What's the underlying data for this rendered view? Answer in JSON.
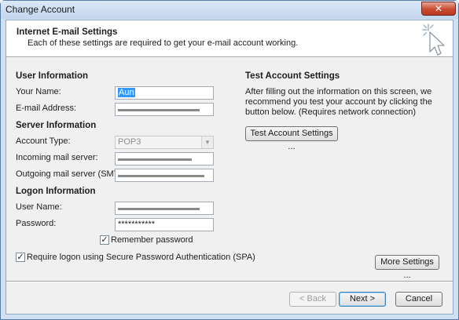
{
  "window": {
    "title": "Change Account",
    "close_glyph": "✕"
  },
  "header": {
    "title": "Internet E-mail Settings",
    "subtitle": "Each of these settings are required to get your e-mail account working.",
    "icon": "cursor-sparkle-icon"
  },
  "user_info": {
    "heading": "User Information",
    "your_name_label": "Your Name:",
    "your_name_value": "Aun",
    "email_label": "E-mail Address:"
  },
  "server_info": {
    "heading": "Server Information",
    "account_type_label": "Account Type:",
    "account_type_value": "POP3",
    "incoming_label": "Incoming mail server:",
    "outgoing_label": "Outgoing mail server (SMTP):"
  },
  "logon_info": {
    "heading": "Logon Information",
    "username_label": "User Name:",
    "password_label": "Password:",
    "password_value": "***********",
    "remember_label": "Remember password",
    "remember_checked": true,
    "spa_label": "Require logon using Secure Password Authentication (SPA)",
    "spa_checked": true
  },
  "test_settings": {
    "heading": "Test Account Settings",
    "description": "After filling out the information on this screen, we recommend you test your account by clicking the button below. (Requires network connection)",
    "button_label": "Test Account Settings ..."
  },
  "buttons": {
    "more_settings": "More Settings ...",
    "back": "< Back",
    "next": "Next >",
    "cancel": "Cancel"
  },
  "check_glyph": "✓"
}
